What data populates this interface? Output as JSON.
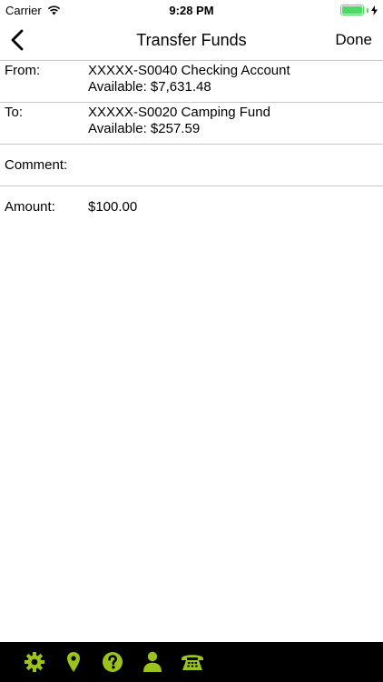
{
  "status_bar": {
    "carrier": "Carrier",
    "time": "9:28 PM",
    "icons": [
      "wifi-icon",
      "battery-icon",
      "charging-bolt-icon"
    ]
  },
  "nav": {
    "back_icon": "chevron-left-icon",
    "title": "Transfer Funds",
    "done_label": "Done"
  },
  "form": {
    "from": {
      "label": "From:",
      "account": "XXXXX-S0040 Checking Account",
      "available": "Available: $7,631.48"
    },
    "to": {
      "label": "To:",
      "account": "XXXXX-S0020 Camping Fund",
      "available": "Available: $257.59"
    },
    "comment": {
      "label": "Comment:",
      "value": ""
    },
    "amount": {
      "label": "Amount:",
      "value": "$100.00"
    }
  },
  "tab_bar": {
    "accent_color": "#9ac31c",
    "background_color": "#000000",
    "tabs": [
      "gear-icon",
      "location-pin-icon",
      "help-icon",
      "person-icon",
      "phone-icon"
    ]
  }
}
